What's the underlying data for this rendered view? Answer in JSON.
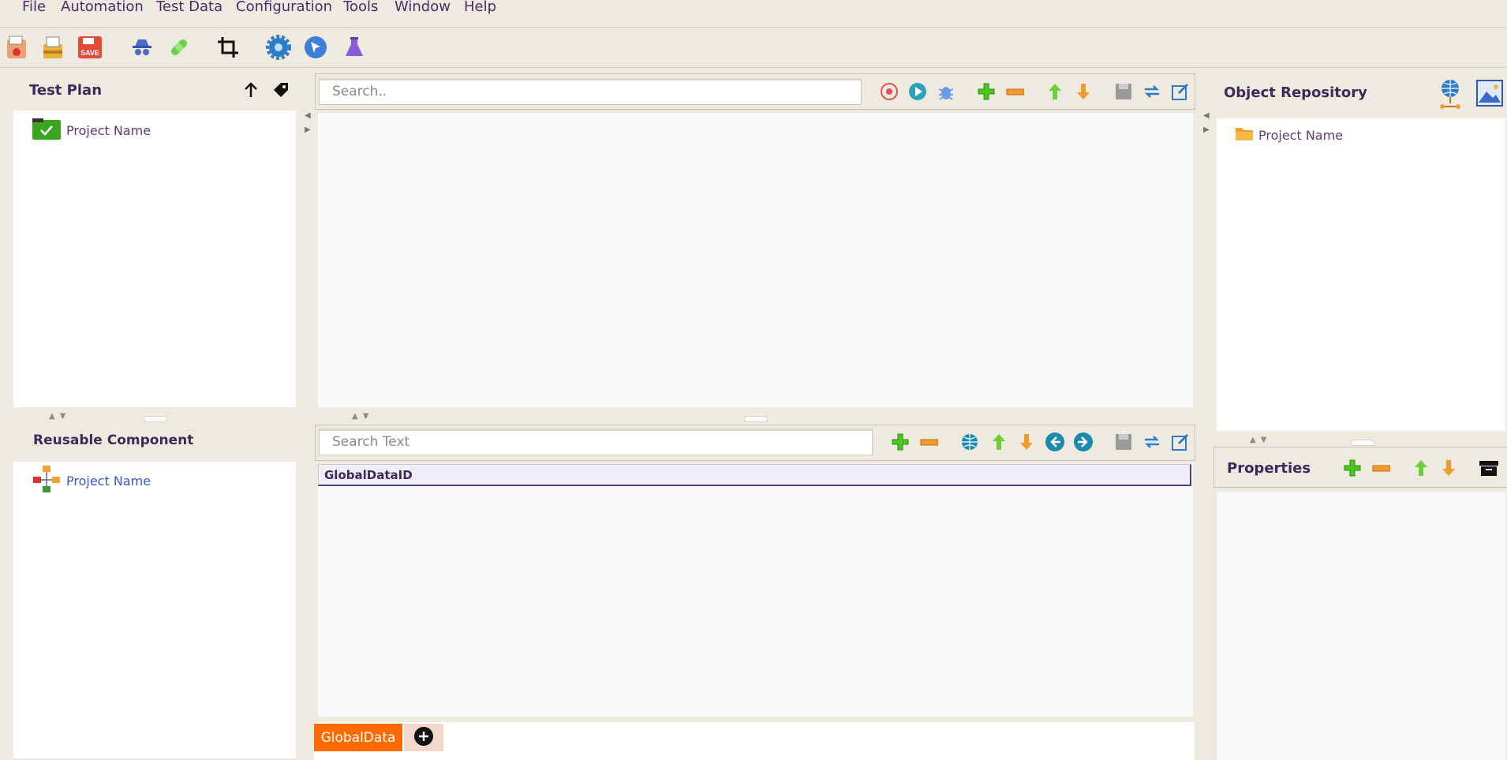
{
  "menubar": {
    "items": [
      {
        "label": "File"
      },
      {
        "label": "Automation"
      },
      {
        "label": "Test Data"
      },
      {
        "label": "Configuration"
      },
      {
        "label": "Tools"
      },
      {
        "label": "Window"
      },
      {
        "label": "Help"
      }
    ]
  },
  "toolbar_icons": [
    "new-project-icon",
    "open-project-icon",
    "save-icon",
    "spy-icon",
    "heal-icon",
    "crop-icon",
    "settings-icon",
    "navigate-icon",
    "lab-icon"
  ],
  "test_plan": {
    "title": "Test Plan",
    "project": "Project Name"
  },
  "reusable_component": {
    "title": "Reusable Component",
    "project": "Project Name"
  },
  "editor": {
    "search_placeholder": "Search.."
  },
  "test_data": {
    "search_placeholder": "Search Text",
    "column_header": "GlobalDataID",
    "tab_label": "GlobalData"
  },
  "object_repository": {
    "title": "Object Repository",
    "project": "Project Name"
  },
  "properties": {
    "title": "Properties"
  },
  "colors": {
    "background": "#efeae0",
    "accent_tab": "#ff6a00",
    "title_text": "#3b2a5a"
  }
}
